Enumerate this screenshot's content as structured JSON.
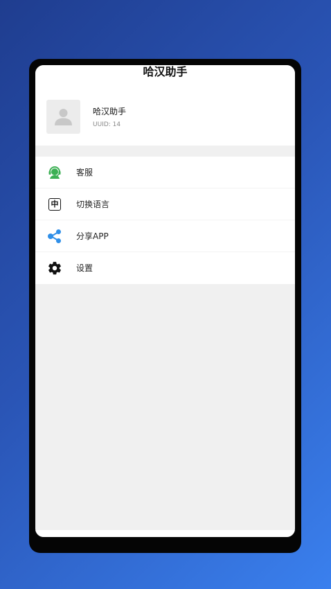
{
  "app": {
    "title": "哈汉助手"
  },
  "profile": {
    "name": "哈汉助手",
    "uuid": "UUID: 14"
  },
  "menu": {
    "items": [
      {
        "label": "客服",
        "icon": "customer-service-icon",
        "color": "#3cb054"
      },
      {
        "label": "切换语言",
        "icon": "language-zh-icon",
        "icon_text": "中",
        "color": "#111111"
      },
      {
        "label": "分享APP",
        "icon": "share-icon",
        "color": "#2f8fe8"
      },
      {
        "label": "设置",
        "icon": "gear-icon",
        "color": "#111111"
      }
    ]
  },
  "colors": {
    "background_start": "#1f3d8f",
    "background_end": "#3a80ee",
    "page_bg": "#f0f0f0"
  }
}
